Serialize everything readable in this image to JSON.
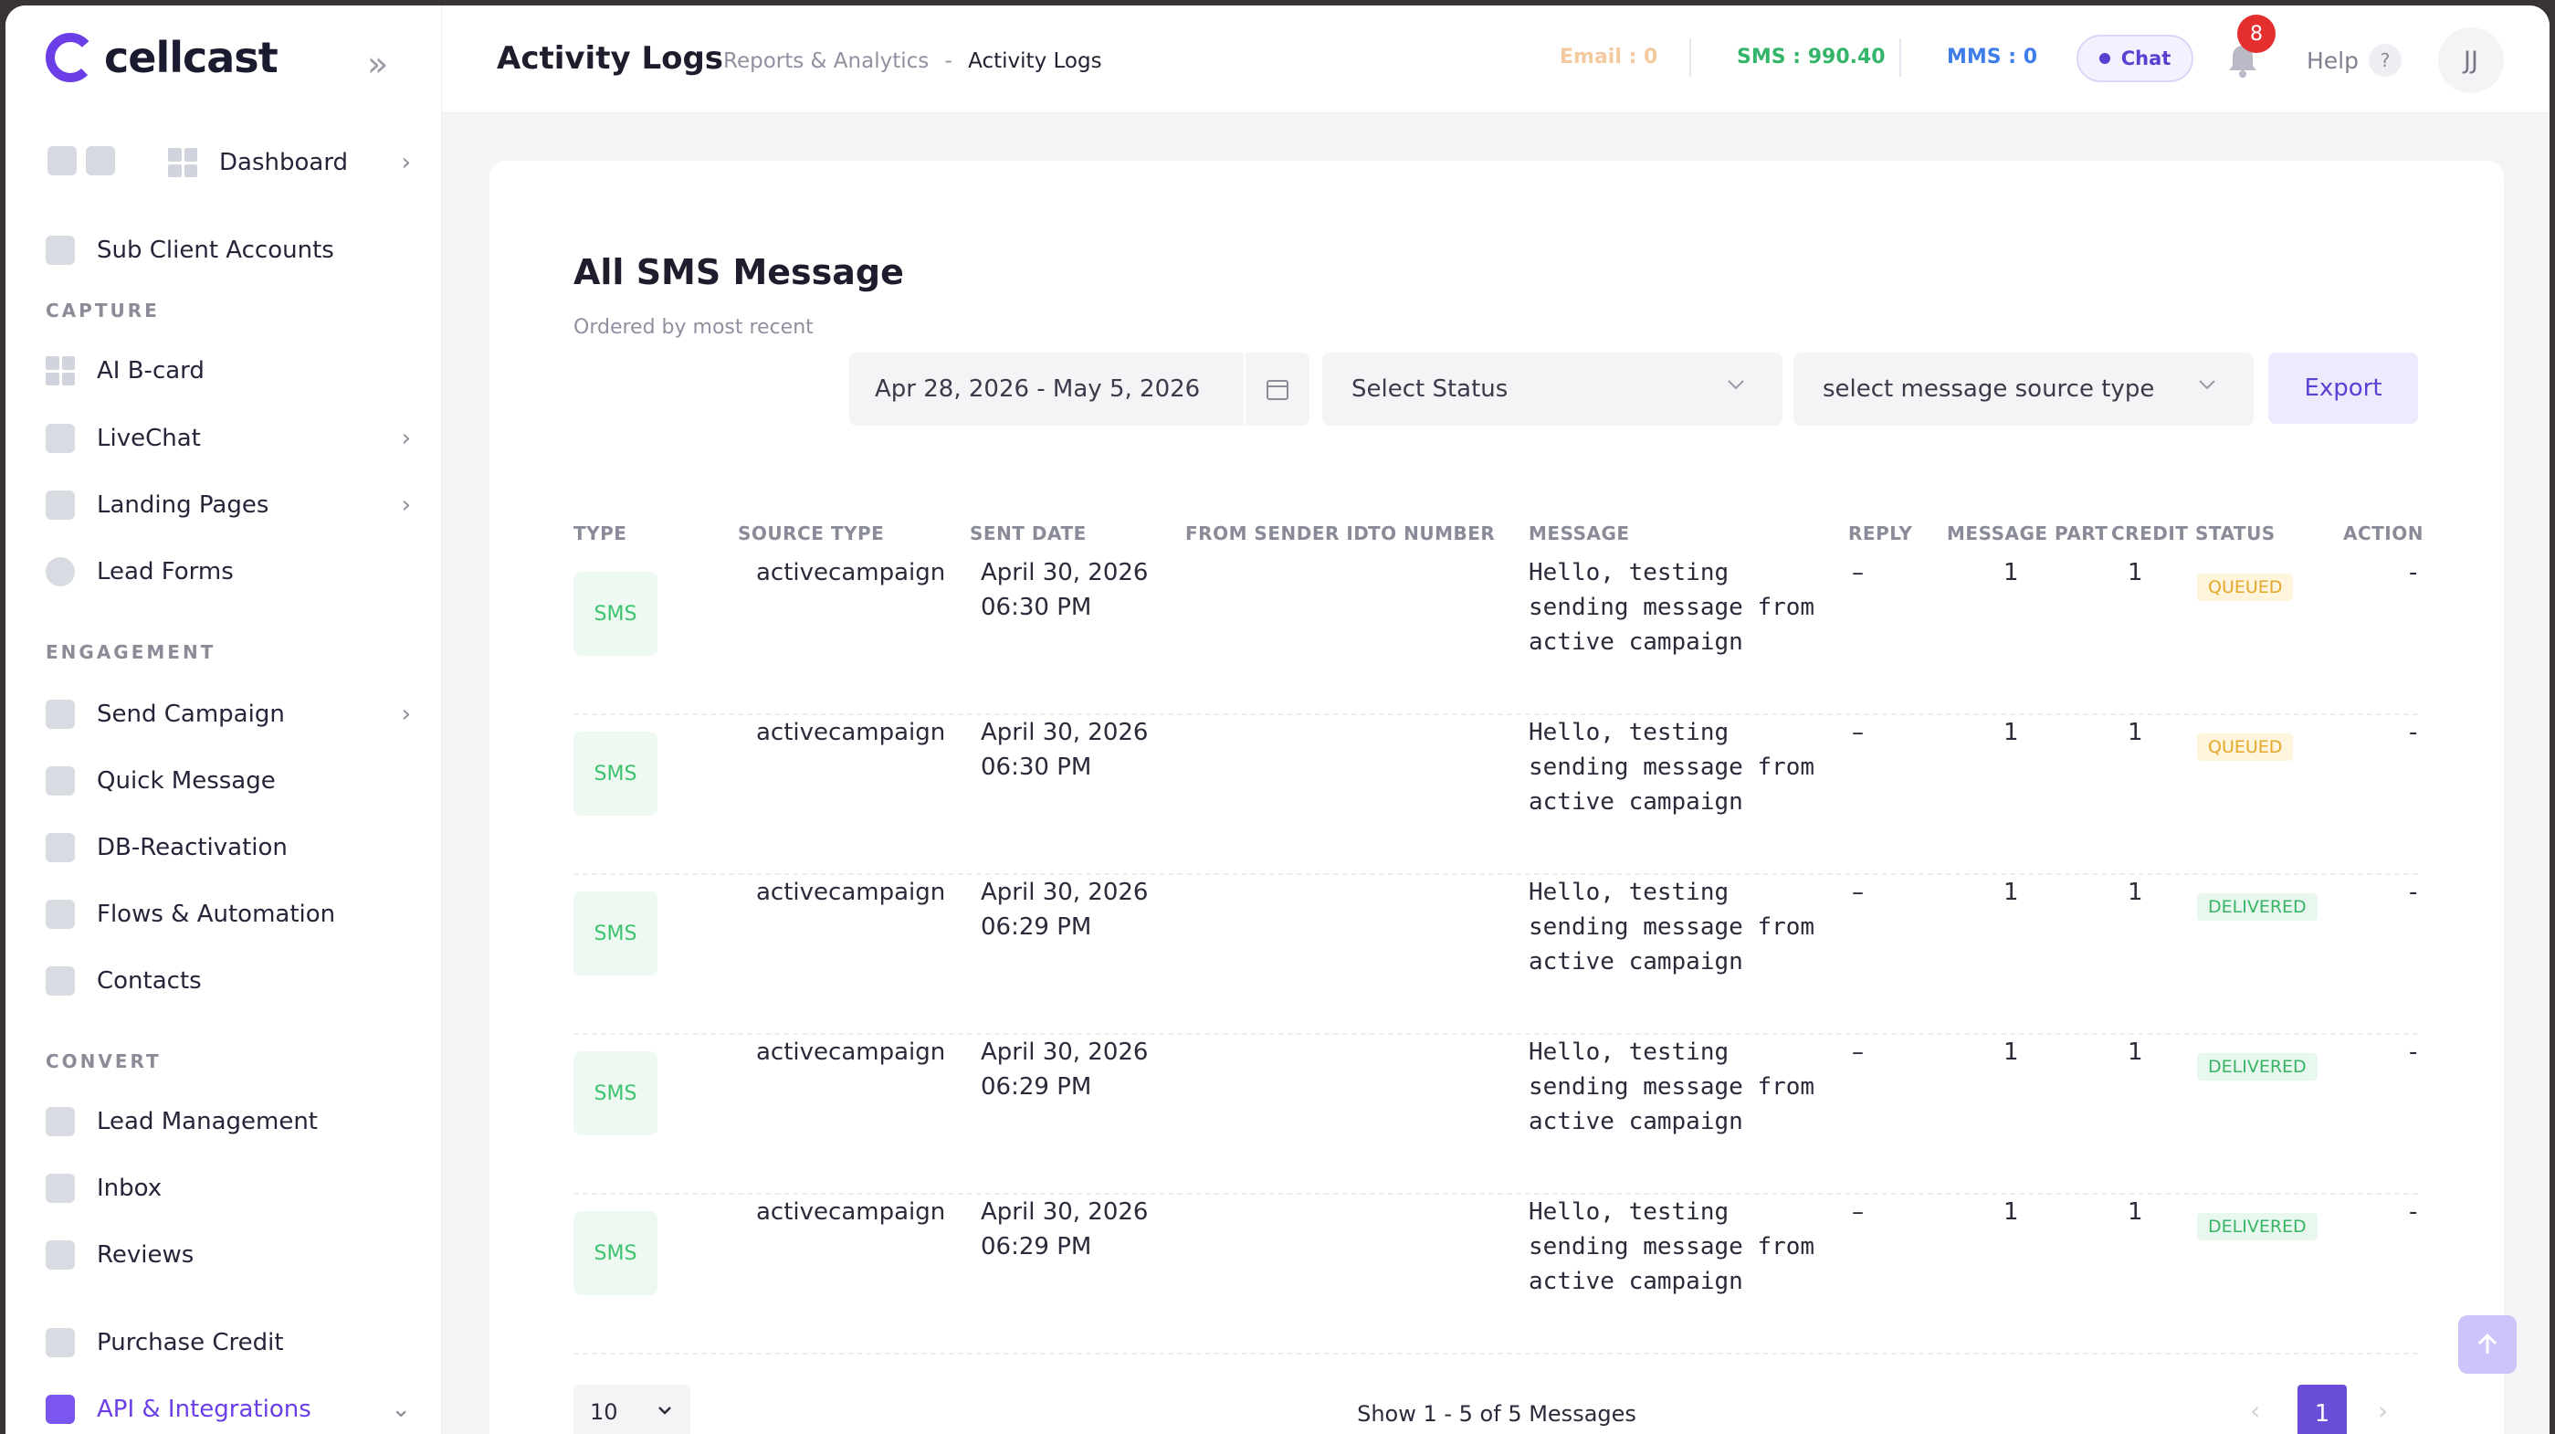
{
  "app": {
    "name": "cellcast"
  },
  "sidebar": {
    "dashboard": "Dashboard",
    "sub_client_accounts": "Sub Client Accounts",
    "sections": {
      "capture": "CAPTURE",
      "engagement": "ENGAGEMENT",
      "convert": "CONVERT"
    },
    "capture_items": [
      "AI B-card",
      "LiveChat",
      "Landing Pages",
      "Lead Forms"
    ],
    "engagement_items": [
      "Send Campaign",
      "Quick Message",
      "DB-Reactivation",
      "Flows & Automation",
      "Contacts"
    ],
    "convert_items": [
      "Lead Management",
      "Inbox",
      "Reviews"
    ],
    "purchase_credit": "Purchase Credit",
    "api_integrations": "API & Integrations"
  },
  "header": {
    "title": "Activity Logs",
    "breadcrumb": {
      "parent": "Reports & Analytics",
      "sep": "-",
      "current": "Activity Logs"
    },
    "email": "Email : 0",
    "sms": "SMS : 990.40",
    "mms": "MMS : 0",
    "chat": "Chat",
    "notifications": "8",
    "help": "Help",
    "help_icon": "?",
    "avatar": "JJ"
  },
  "card": {
    "title": "All SMS Message",
    "subtitle": "Ordered by most recent",
    "filters": {
      "date_range": "Apr 28, 2026 - May 5, 2026",
      "status": "Select Status",
      "source": "select message source type"
    },
    "export": "Export",
    "columns": [
      "TYPE",
      "SOURCE TYPE",
      "SENT DATE",
      "FROM SENDER ID",
      "TO NUMBER",
      "MESSAGE",
      "REPLY",
      "MESSAGE PART",
      "CREDIT",
      "STATUS",
      "ACTION"
    ],
    "rows": [
      {
        "type": "SMS",
        "source": "activecampaign",
        "date": "April 30, 2026",
        "time": "06:30 PM",
        "message": "Hello, testing sending message from active campaign",
        "reply": "–",
        "parts": "1",
        "credit": "1",
        "status": "QUEUED",
        "action": "-"
      },
      {
        "type": "SMS",
        "source": "activecampaign",
        "date": "April 30, 2026",
        "time": "06:30 PM",
        "message": "Hello, testing sending message from active campaign",
        "reply": "–",
        "parts": "1",
        "credit": "1",
        "status": "QUEUED",
        "action": "-"
      },
      {
        "type": "SMS",
        "source": "activecampaign",
        "date": "April 30, 2026",
        "time": "06:29 PM",
        "message": "Hello, testing sending message from active campaign",
        "reply": "–",
        "parts": "1",
        "credit": "1",
        "status": "DELIVERED",
        "action": "-"
      },
      {
        "type": "SMS",
        "source": "activecampaign",
        "date": "April 30, 2026",
        "time": "06:29 PM",
        "message": "Hello, testing sending message from active campaign",
        "reply": "–",
        "parts": "1",
        "credit": "1",
        "status": "DELIVERED",
        "action": "-"
      },
      {
        "type": "SMS",
        "source": "activecampaign",
        "date": "April 30, 2026",
        "time": "06:29 PM",
        "message": "Hello, testing sending message from active campaign",
        "reply": "–",
        "parts": "1",
        "credit": "1",
        "status": "DELIVERED",
        "action": "-"
      }
    ],
    "page_size": "10",
    "show_count": "Show 1 - 5 of 5 Messages",
    "current_page": "1"
  },
  "colors": {
    "brand": "#6b3ee8",
    "sms": "#35b56a",
    "mms": "#3f7de8",
    "email": "#f4c9a0",
    "badge": "#e52f2f"
  }
}
